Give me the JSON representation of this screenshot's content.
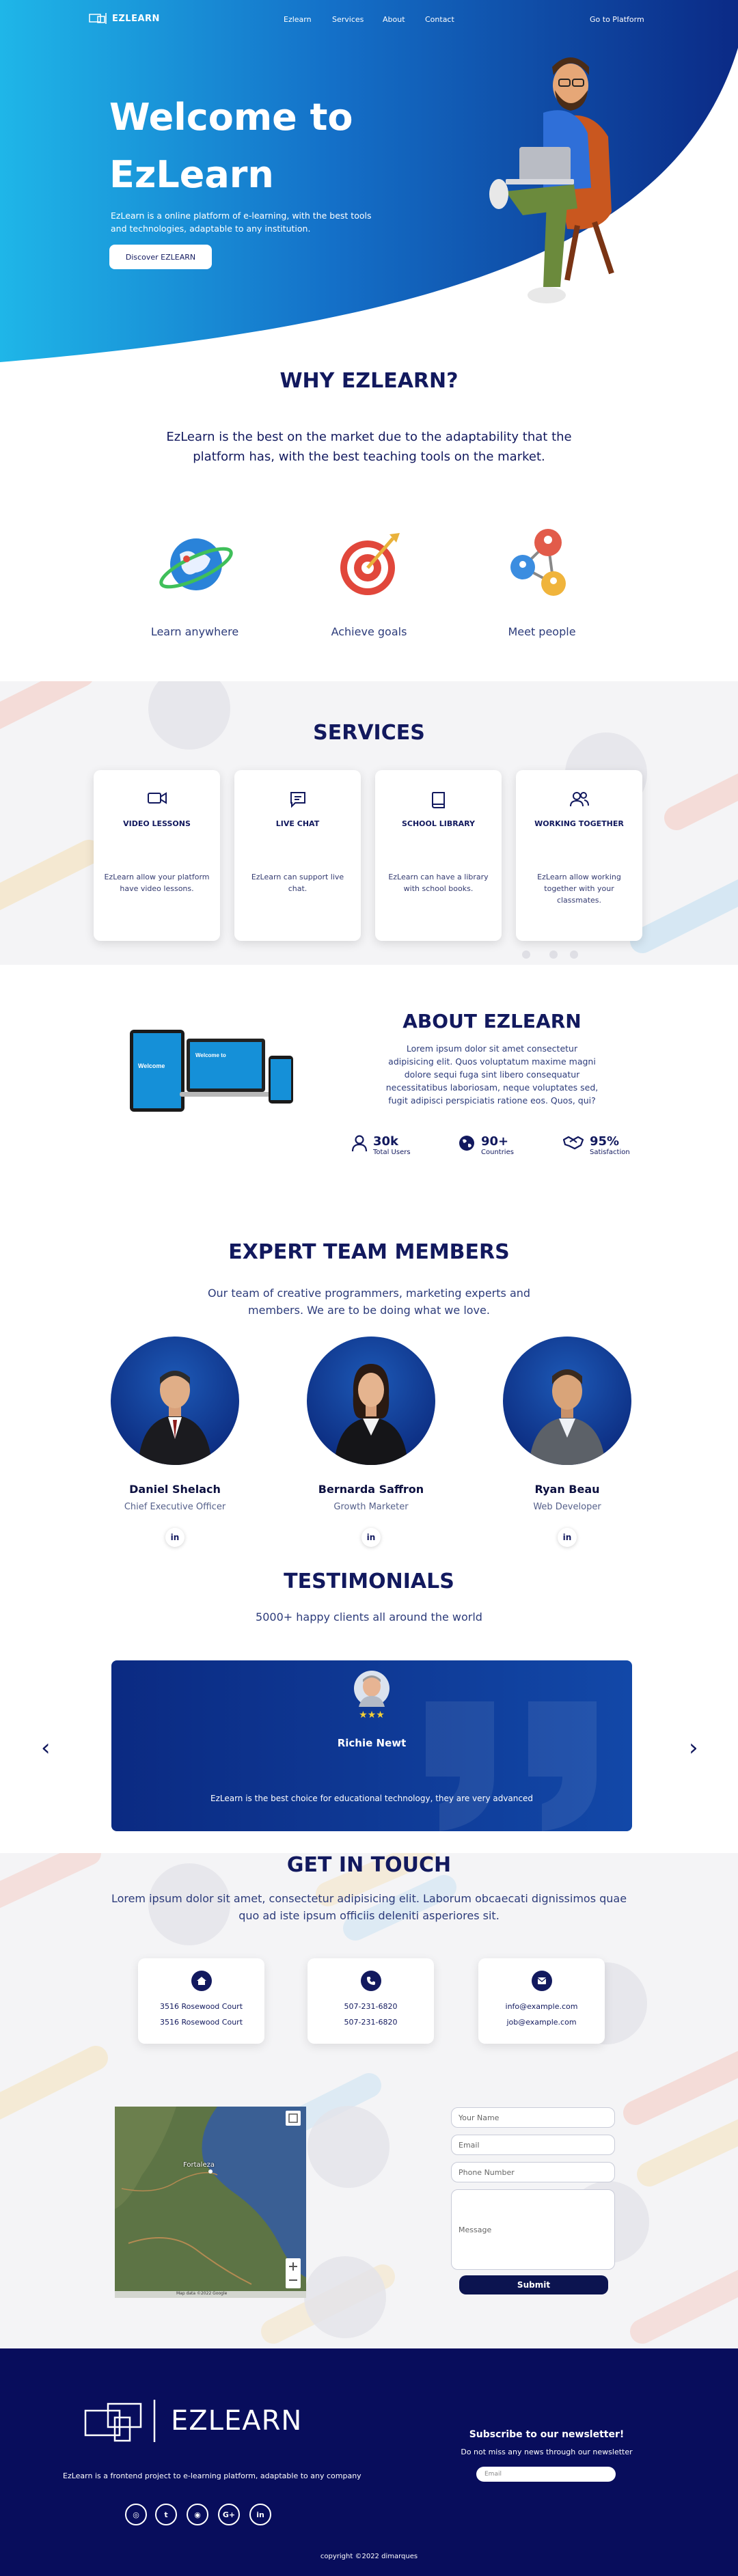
{
  "nav": {
    "logo": "EZLEARN",
    "links": [
      "Ezlearn",
      "Services",
      "About",
      "Contact"
    ],
    "platform": "Go to Platform"
  },
  "hero": {
    "title_line1": "Welcome to",
    "title_line2": "EzLearn",
    "description": "EzLearn is a online platform of e-learning, with the best tools and technologies, adaptable to any institution.",
    "button": "Discover EZLEARN"
  },
  "why": {
    "title": "WHY EZLEARN?",
    "text": "EzLearn is the best on the market due to the adaptability that the platform has, with the best teaching tools on the market.",
    "features": [
      "Learn anywhere",
      "Achieve goals",
      "Meet people"
    ]
  },
  "services": {
    "title": "SERVICES",
    "cards": [
      {
        "icon": "video-icon",
        "title": "VIDEO LESSONS",
        "text": "EzLearn allow your platform have video lessons."
      },
      {
        "icon": "chat-icon",
        "title": "LIVE CHAT",
        "text": "EzLearn can support live chat."
      },
      {
        "icon": "book-icon",
        "title": "SCHOOL LIBRARY",
        "text": "EzLearn can have a library with school books."
      },
      {
        "icon": "users-icon",
        "title": "WORKING TOGETHER",
        "text": "EzLearn allow working together with your classmates."
      }
    ]
  },
  "about": {
    "title": "ABOUT EZLEARN",
    "text": "Lorem ipsum dolor sit amet consectetur adipisicing elit. Quos voluptatum maxime magni dolore sequi fuga sint libero consequatur necessitatibus laboriosam, neque voluptates sed, fugit adipisci perspiciatis ratione eos. Quos, qui?",
    "mockup_text": "Welcome to EzLearn",
    "stats": [
      {
        "icon": "user-icon",
        "value": "30k",
        "label": "Total Users"
      },
      {
        "icon": "globe-icon",
        "value": "90+",
        "label": "Countries"
      },
      {
        "icon": "handshake-icon",
        "value": "95%",
        "label": "Satisfaction"
      }
    ]
  },
  "team": {
    "title": "EXPERT TEAM MEMBERS",
    "subtitle": "Our team of creative programmers, marketing experts and members. We are to be doing what we love.",
    "members": [
      {
        "name": "Daniel Shelach",
        "role": "Chief Executive Officer"
      },
      {
        "name": "Bernarda Saffron",
        "role": "Growth Marketer"
      },
      {
        "name": "Ryan Beau",
        "role": "Web Developer"
      }
    ],
    "social": "in"
  },
  "testimonials": {
    "title": "TESTIMONIALS",
    "subtitle": "5000+ happy clients all around the world",
    "name": "Richie Newt",
    "stars": "★★★",
    "quote": "EzLearn is the best choice for educational technology, they are very advanced",
    "prev": "‹",
    "next": "›"
  },
  "contact": {
    "title": "GET IN TOUCH",
    "text": "Lorem ipsum dolor sit amet, consectetur adipisicing elit. Laborum obcaecati dignissimos quae quo ad iste ipsum officiis deleniti asperiores sit.",
    "cards": [
      {
        "icon": "home-icon",
        "line1": "3516 Rosewood Court",
        "line2": "3516 Rosewood Court"
      },
      {
        "icon": "phone-icon",
        "line1": "507-231-6820",
        "line2": "507-231-6820"
      },
      {
        "icon": "mail-icon",
        "line1": "info@example.com",
        "line2": "job@example.com"
      }
    ],
    "form": {
      "name_placeholder": "Your Name",
      "email_placeholder": "Email",
      "phone_placeholder": "Phone Number",
      "message_placeholder": "Message",
      "submit": "Submit"
    },
    "map": {
      "city": "Fortaleza",
      "attribution": "Map data ©2022 Google"
    }
  },
  "footer": {
    "logo": "EZLEARN",
    "tagline": "EzLearn is a frontend project to e-learning platform, adaptable to any company",
    "newsletter_title": "Subscribe to our newsletter!",
    "newsletter_text": "Do not miss any news through our newsletter",
    "email_placeholder": "Email",
    "social": [
      "whatsapp-icon",
      "twitter-icon",
      "instagram-icon",
      "google-plus-icon",
      "linkedin-icon"
    ],
    "social_labels": [
      "◎",
      "t",
      "◉",
      "G+",
      "in"
    ],
    "copyright": "copyright ©2022 dimarques"
  }
}
